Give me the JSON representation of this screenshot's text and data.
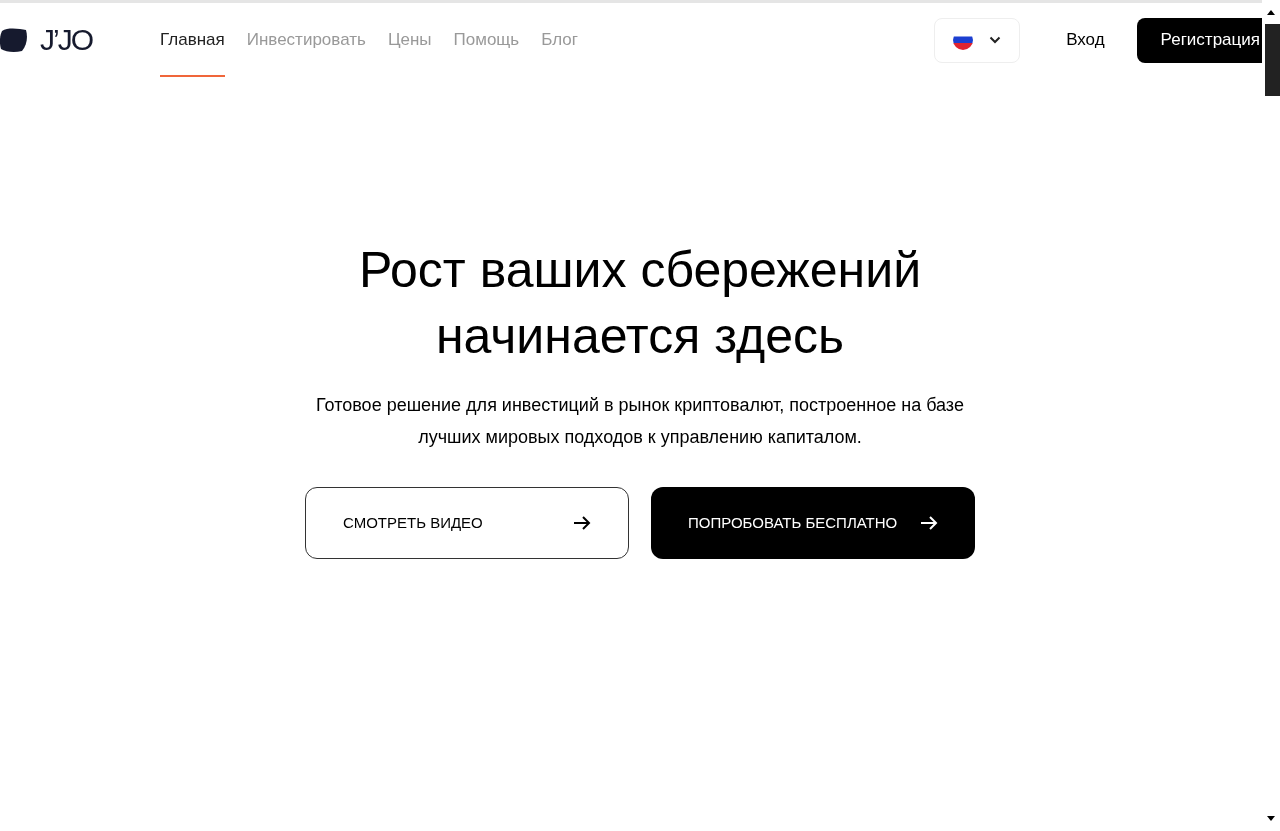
{
  "logo": {
    "text": "J’JO"
  },
  "nav": [
    {
      "label": "Главная",
      "selected": true
    },
    {
      "label": "Инвестировать",
      "selected": false
    },
    {
      "label": "Цены",
      "selected": false
    },
    {
      "label": "Помощь",
      "selected": false
    },
    {
      "label": "Блог",
      "selected": false
    }
  ],
  "login": "Вход",
  "register": "Регистрация",
  "hero": {
    "title_lines": [
      "Рост ваших сбережений",
      "начинается здесь"
    ],
    "subtitle": "Готовое решение для инвестиций в рынок криптовалют, построенное на базе лучших мировых подходов к управлению капиталом."
  },
  "buttons": [
    {
      "label": "СМОТРЕТЬ ВИДЕО",
      "kind": "outline"
    },
    {
      "label": "ПОПРОБОВАТЬ БЕСПЛАТНО",
      "kind": "filled"
    }
  ]
}
